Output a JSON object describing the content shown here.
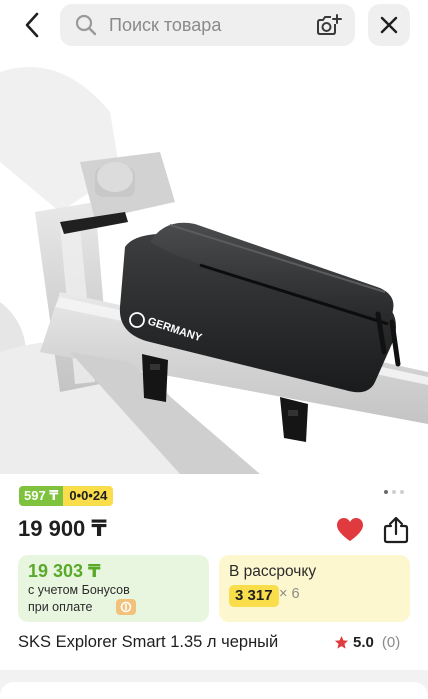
{
  "header": {
    "search_placeholder": "Поиск товара",
    "icons": {
      "back": "chevron-left-icon",
      "search": "search-icon",
      "camera": "camera-plus-icon",
      "close": "close-icon"
    }
  },
  "product": {
    "badges": {
      "bonus": "597 ₸",
      "installment": "0•0•24"
    },
    "gallery": {
      "current": 1,
      "total": 3
    },
    "price": "19 900 ₸",
    "favorite": true,
    "bonus_card": {
      "price": "19 303 ₸",
      "line1": "с учетом Бонусов",
      "line2": "при оплате"
    },
    "installment_card": {
      "title": "В рассрочку",
      "amount": "3 317",
      "multiplier": "× 6"
    },
    "title": "SKS Explorer Smart 1.35 л черный",
    "rating": {
      "value": "5.0",
      "count": "(0)"
    },
    "image_brand": "GERMANY"
  },
  "colors": {
    "accent_green": "#7ec23d",
    "accent_yellow": "#f9dd4a",
    "heart_red": "#e0393e",
    "star_red": "#e0393e",
    "bonus_text_green": "#5aa92b"
  }
}
